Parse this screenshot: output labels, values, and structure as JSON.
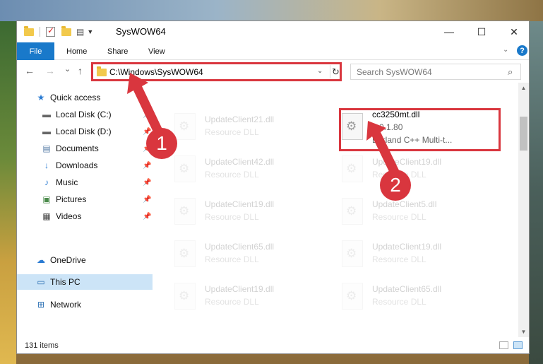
{
  "titlebar": {
    "title": "SysWOW64",
    "minimize_glyph": "—",
    "maximize_glyph": "☐",
    "close_glyph": "✕"
  },
  "ribbon": {
    "tabs": [
      "File",
      "Home",
      "Share",
      "View"
    ],
    "help_glyph": "?"
  },
  "navigation": {
    "back_glyph": "←",
    "forward_glyph": "→",
    "recent_glyph": "⌄",
    "up_glyph": "↑",
    "address": "C:\\Windows\\SysWOW64",
    "refresh_glyph": "↻",
    "search_placeholder": "Search SysWOW64"
  },
  "sidebar": {
    "items": [
      {
        "label": "Quick access",
        "icon": "star-icon"
      },
      {
        "label": "Local Disk (C:)",
        "icon": "drive-icon",
        "pinned": true
      },
      {
        "label": "Local Disk (D:)",
        "icon": "drive-icon",
        "pinned": true
      },
      {
        "label": "Documents",
        "icon": "documents-icon",
        "pinned": true
      },
      {
        "label": "Downloads",
        "icon": "downloads-icon",
        "pinned": true
      },
      {
        "label": "Music",
        "icon": "music-icon",
        "pinned": true
      },
      {
        "label": "Pictures",
        "icon": "pictures-icon",
        "pinned": true
      },
      {
        "label": "Videos",
        "icon": "videos-icon",
        "pinned": true
      },
      {
        "label": "OneDrive",
        "icon": "cloud-icon"
      },
      {
        "label": "This PC",
        "icon": "computer-icon",
        "selected": true
      },
      {
        "label": "Network",
        "icon": "network-icon"
      }
    ]
  },
  "files": [
    {
      "name": "UpdateClient21.dll",
      "desc": "Resource DLL"
    },
    {
      "name": "cc3250mt.dll",
      "desc": "5.0.1.80",
      "desc2": "Borland C++ Multi-t...",
      "highlighted": true
    },
    {
      "name": "UpdateClient42.dll",
      "desc": "Resource DLL"
    },
    {
      "name": "UpdateClient19.dll",
      "desc": "Resource DLL"
    },
    {
      "name": "UpdateClient19.dll",
      "desc": "Resource DLL"
    },
    {
      "name": "UpdateClient5.dll",
      "desc": "Resource DLL"
    },
    {
      "name": "UpdateClient65.dll",
      "desc": "Resource DLL"
    },
    {
      "name": "UpdateClient19.dll",
      "desc": "Resource DLL"
    },
    {
      "name": "UpdateClient19.dll",
      "desc": "Resource DLL"
    },
    {
      "name": "UpdateClient65.dll",
      "desc": "Resource DLL"
    }
  ],
  "status": {
    "item_count": "131 items"
  },
  "callouts": {
    "step1": "1",
    "step2": "2",
    "color": "#d9363e"
  }
}
